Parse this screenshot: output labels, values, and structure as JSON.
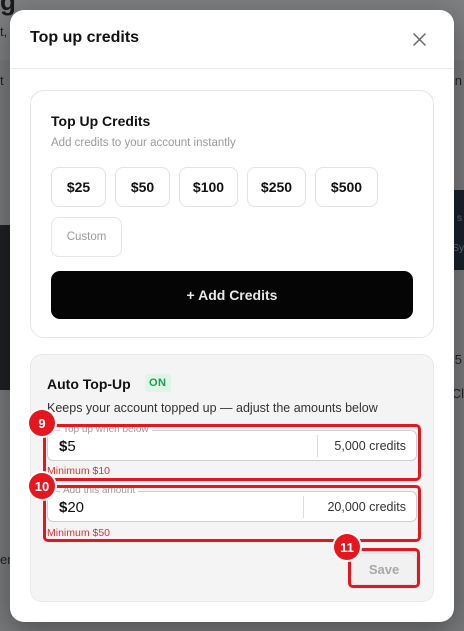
{
  "background": {
    "fragment_title": "g",
    "fragment_top": "t,",
    "fragment_left_1": "t",
    "fragment_left_2": "er",
    "fragment_right_1": "n",
    "fragment_right_2": "5",
    "fragment_right_3": "Cl",
    "fragment_right_4": "s",
    "fragment_right_5": "Sy"
  },
  "dialog": {
    "title": "Top up credits",
    "close_icon": "close-icon"
  },
  "topup": {
    "title": "Top Up Credits",
    "subtitle": "Add credits to your account instantly",
    "amounts": [
      "$25",
      "$50",
      "$100",
      "$250",
      "$500"
    ],
    "custom_placeholder": "Custom",
    "add_button": "+ Add Credits"
  },
  "auto_topup": {
    "title": "Auto Top-Up",
    "status": "ON",
    "description": "Keeps your account topped up — adjust the amounts below",
    "threshold": {
      "label": "Top up when below",
      "currency": "$",
      "value": "5",
      "credits": "5,000 credits",
      "hint": "Minimum $10"
    },
    "amount": {
      "label": "Add this amount",
      "currency": "$",
      "value": "20",
      "credits": "20,000 credits",
      "hint": "Minimum $50"
    },
    "save_button": "Save"
  },
  "annotations": [
    "9",
    "10",
    "11"
  ],
  "colors": {
    "primary_button": "#050505",
    "badge_bg": "#dff5e5",
    "badge_text": "#16a34a",
    "error": "#e0312f",
    "annotation": "#e5161d"
  }
}
